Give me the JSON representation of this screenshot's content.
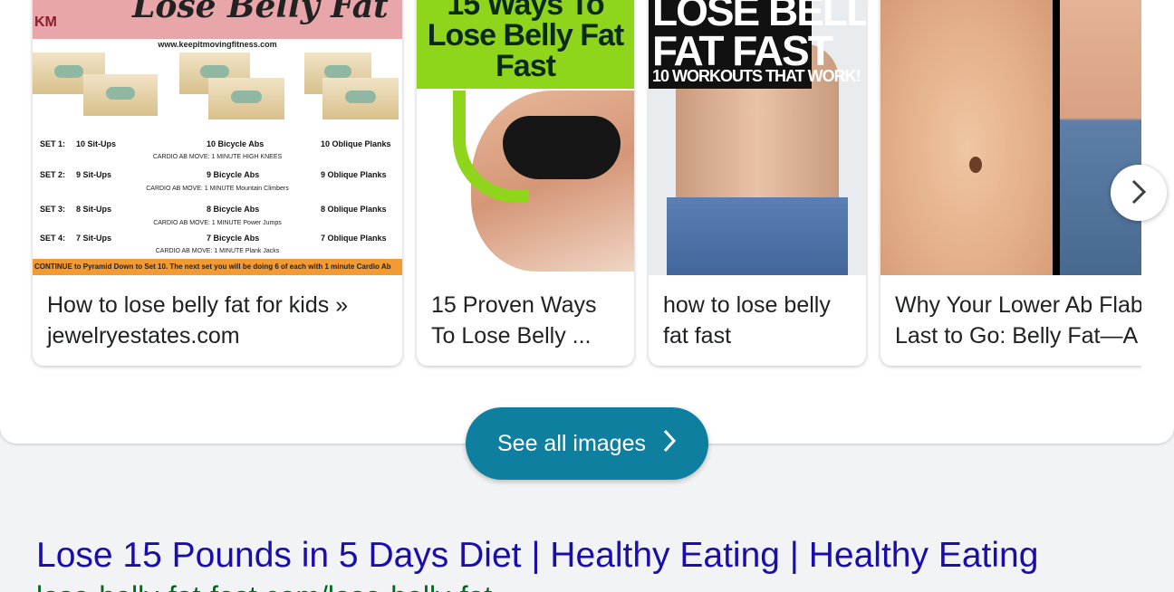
{
  "carousel": {
    "cards": [
      {
        "caption_line1": "How to lose belly fat for kids »",
        "caption_line2": "jewelryestates.com",
        "image": {
          "header_text": "Lose Belly Fat",
          "logo": "KM",
          "site": "www.keepitmovingfitness.com",
          "sets": [
            {
              "label": "SET 1:",
              "a": "10 Sit-Ups",
              "b": "10 Bicycle Abs",
              "c": "10 Oblique Planks",
              "cardio": "CARDIO AB MOVE: 1 MINUTE  HIGH KNEES"
            },
            {
              "label": "SET 2:",
              "a": "9 Sit-Ups",
              "b": "9 Bicycle Abs",
              "c": "9 Oblique Planks",
              "cardio": "CARDIO AB MOVE: 1 MINUTE  Mountain Climbers"
            },
            {
              "label": "SET 3:",
              "a": "8 Sit-Ups",
              "b": "8 Bicycle Abs",
              "c": "8 Oblique Planks",
              "cardio": "CARDIO AB MOVE: 1 MINUTE  Power Jumps"
            },
            {
              "label": "SET 4:",
              "a": "7 Sit-Ups",
              "b": "7 Bicycle Abs",
              "c": "7 Oblique Planks",
              "cardio": "CARDIO AB MOVE: 1 MINUTE  Plank Jacks"
            }
          ],
          "footer": "CONTINUE to Pyramid Down to Set 10. The next set you will be doing 6 of each with 1 minute Cardio Ab"
        }
      },
      {
        "caption_line1": "15 Proven Ways",
        "caption_line2": "To Lose Belly ...",
        "image": {
          "title_lines": [
            "15 Ways To",
            "Lose Belly Fat",
            "Fast"
          ]
        }
      },
      {
        "caption_line1": "how to lose belly",
        "caption_line2": "fat fast",
        "image": {
          "title_lines": [
            "LOSE BELLY",
            "FAT FAST"
          ],
          "subtitle": "10 WORKOUTS THAT WORK!"
        }
      },
      {
        "caption_line1": "Why Your Lower Ab Flab",
        "caption_line2": "Last to Go: Belly Fat—A",
        "image": {}
      }
    ],
    "next_icon": "chevron-right-icon"
  },
  "see_all": {
    "label": "See all images",
    "icon": "chevron-right-icon"
  },
  "result": {
    "title": "Lose 15 Pounds in 5 Days Diet | Healthy Eating | Healthy Eating",
    "url": "lose-belly-fat-fast.com/lose-belly-fat"
  },
  "colors": {
    "accent_button": "#0f7f9f",
    "link_title": "#1a0dab",
    "url_green": "#006621"
  }
}
